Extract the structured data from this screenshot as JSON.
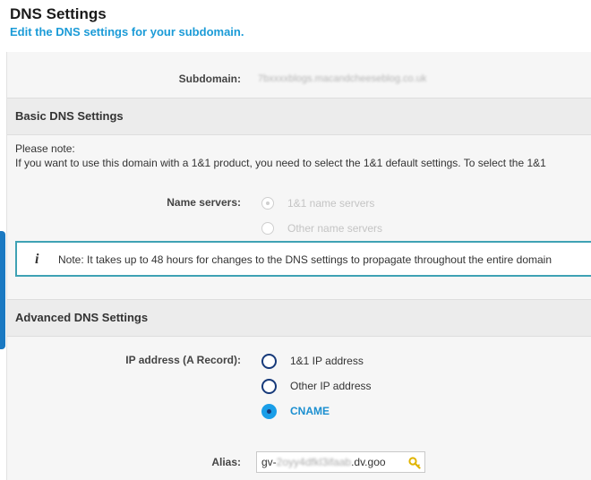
{
  "header": {
    "title": "DNS Settings",
    "subtitle": "Edit the DNS settings for your subdomain."
  },
  "subdomain": {
    "label": "Subdomain:",
    "value": "7bxxxxblogs.macandcheeseblog.co.uk"
  },
  "basic": {
    "title": "Basic DNS Settings",
    "note_heading": "Please note:",
    "note_body": "If you want to use this domain with a 1&1 product, you need to select the 1&1 default settings. To select the 1&1",
    "name_servers_label": "Name servers:",
    "name_server_options": [
      {
        "label": "1&1 name servers",
        "checked": true,
        "disabled": true
      },
      {
        "label": "Other name servers",
        "checked": false,
        "disabled": true
      }
    ]
  },
  "note_box": {
    "icon": "info-icon",
    "text": "Note: It takes up to 48 hours for changes to the DNS settings to propagate throughout the entire domain"
  },
  "advanced": {
    "title": "Advanced DNS Settings",
    "ip_label": "IP address (A Record):",
    "ip_options": [
      {
        "label": "1&1 IP address",
        "checked": false
      },
      {
        "label": "Other IP address",
        "checked": false
      },
      {
        "label": "CNAME",
        "checked": true
      }
    ],
    "alias_label": "Alias:",
    "alias_value_prefix": "gv-",
    "alias_value_blurred": "2oyy4dfkl3ifaab",
    "alias_value_suffix": ".dv.goo"
  },
  "colors": {
    "accent": "#1b9bd7",
    "note_border": "#3fa2b4",
    "radio_active": "#1a9ee8",
    "side_tab": "#1a79c2"
  }
}
